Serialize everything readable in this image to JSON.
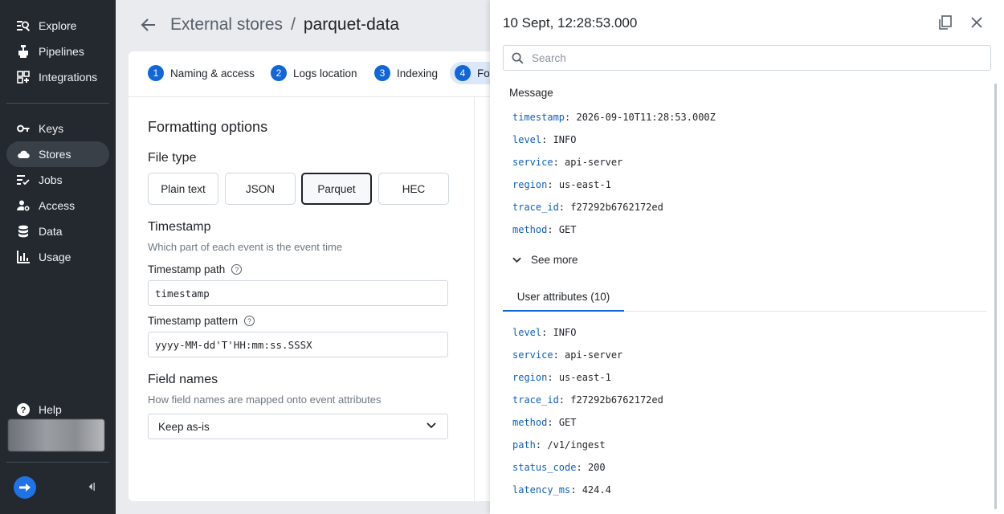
{
  "sidebar": {
    "items": [
      {
        "label": "Explore",
        "icon": "explore-icon"
      },
      {
        "label": "Pipelines",
        "icon": "pipelines-icon"
      },
      {
        "label": "Integrations",
        "icon": "integrations-icon"
      },
      {
        "label": "Keys",
        "icon": "key-icon"
      },
      {
        "label": "Stores",
        "icon": "cloud-icon",
        "active": true
      },
      {
        "label": "Jobs",
        "icon": "jobs-icon"
      },
      {
        "label": "Access",
        "icon": "access-icon"
      },
      {
        "label": "Data",
        "icon": "database-icon"
      },
      {
        "label": "Usage",
        "icon": "chart-icon"
      }
    ],
    "help_label": "Help"
  },
  "header": {
    "crumb_parent": "External stores",
    "crumb_sep": "/",
    "crumb_current": "parquet-data"
  },
  "steps": [
    {
      "num": "1",
      "label": "Naming & access"
    },
    {
      "num": "2",
      "label": "Logs location"
    },
    {
      "num": "3",
      "label": "Indexing"
    },
    {
      "num": "4",
      "label": "Fo"
    }
  ],
  "form": {
    "title": "Formatting options",
    "file_type_heading": "File type",
    "file_types": [
      "Plain text",
      "JSON",
      "Parquet",
      "HEC"
    ],
    "selected_file_type": "Parquet",
    "timestamp_heading": "Timestamp",
    "timestamp_desc": "Which part of each event is the event time",
    "timestamp_path_label": "Timestamp path",
    "timestamp_path_value": "timestamp",
    "timestamp_pattern_label": "Timestamp pattern",
    "timestamp_pattern_value": "yyyy-MM-dd'T'HH:mm:ss.SSSX",
    "field_names_heading": "Field names",
    "field_names_desc": "How field names are mapped onto event attributes",
    "field_names_value": "Keep as-is"
  },
  "drawer": {
    "title": "10 Sept, 12:28:53.000",
    "search_placeholder": "Search",
    "message_label": "Message",
    "message_fields": [
      {
        "k": "timestamp",
        "v": "2026-09-10T11:28:53.000Z"
      },
      {
        "k": "level",
        "v": "INFO"
      },
      {
        "k": "service",
        "v": "api-server"
      },
      {
        "k": "region",
        "v": "us-east-1"
      },
      {
        "k": "trace_id",
        "v": "f27292b6762172ed"
      },
      {
        "k": "method",
        "v": "GET"
      }
    ],
    "see_more": "See more",
    "tab_label": "User attributes (10)",
    "user_attributes": [
      {
        "k": "level",
        "v": "INFO"
      },
      {
        "k": "service",
        "v": "api-server"
      },
      {
        "k": "region",
        "v": "us-east-1"
      },
      {
        "k": "trace_id",
        "v": "f27292b6762172ed"
      },
      {
        "k": "method",
        "v": "GET"
      },
      {
        "k": "path",
        "v": "/v1/ingest"
      },
      {
        "k": "status_code",
        "v": "200"
      },
      {
        "k": "latency_ms",
        "v": "424.4"
      }
    ]
  },
  "colors": {
    "accent": "#1167d8",
    "sidebar_bg": "#24292f",
    "key_blue": "#0f5fbd"
  }
}
